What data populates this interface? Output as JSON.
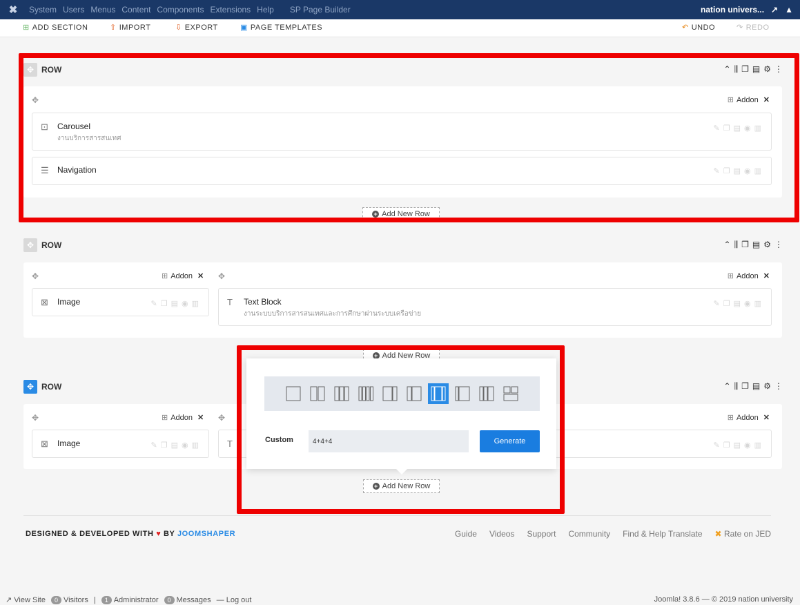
{
  "topbar": {
    "menu": [
      "System",
      "Users",
      "Menus",
      "Content",
      "Components",
      "Extensions",
      "Help"
    ],
    "extension": "SP Page Builder",
    "site_name": "nation univers...",
    "logo_icon": "joomla-logo-icon",
    "user_icon": "user-icon"
  },
  "toolbar": {
    "add_section": "ADD SECTION",
    "import": "IMPORT",
    "export": "EXPORT",
    "page_templates": "PAGE TEMPLATES",
    "undo": "UNDO",
    "redo": "REDO"
  },
  "rows": [
    {
      "label": "ROW",
      "addon_label": "Addon",
      "addons": [
        {
          "icon": "carousel-icon",
          "title": "Carousel",
          "subtitle": "งานบริการสารสนเทศ"
        },
        {
          "icon": "navigation-icon",
          "title": "Navigation",
          "subtitle": ""
        }
      ]
    },
    {
      "label": "ROW",
      "addon_label": "Addon",
      "col1": {
        "icon": "image-icon",
        "title": "Image"
      },
      "col2": {
        "icon": "text-icon",
        "title": "Text Block",
        "subtitle": "งานระบบบริการสารสนเทศและการศึกษาผ่านระบบเครือข่าย"
      }
    },
    {
      "label": "ROW",
      "addon_label": "Addon",
      "col1": {
        "icon": "image-icon",
        "title": "Image"
      }
    }
  ],
  "add_new_row": "Add New Row",
  "popover": {
    "custom_label": "Custom",
    "custom_value": "4+4+4",
    "generate": "Generate",
    "selected_layout": "4+4+4"
  },
  "footer": {
    "designed": "DESIGNED & DEVELOPED WITH",
    "by": "BY",
    "brand": "JOOMSHAPER",
    "links": [
      "Guide",
      "Videos",
      "Support",
      "Community",
      "Find & Help Translate",
      "Rate on JED"
    ]
  },
  "status": {
    "view_site": "View Site",
    "visitors_count": "0",
    "visitors": "Visitors",
    "admin_count": "1",
    "administrator": "Administrator",
    "messages_count": "0",
    "messages": "Messages",
    "logout": "Log out",
    "version": "Joomla! 3.8.6 — © 2019 nation university"
  },
  "colors": {
    "topbar": "#1a3867",
    "accent": "#2a8be5",
    "highlight": "#ee0000"
  }
}
